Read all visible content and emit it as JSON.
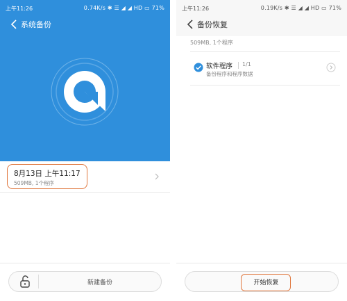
{
  "left": {
    "status": {
      "time": "上午11:26",
      "right": "0.74K/s ✱ ☰ ◢ ◢ HD ▭ 71%"
    },
    "title": "系统备份",
    "record": {
      "date": "8月13日 上午11:17",
      "sub": "509MB, 1个程序"
    },
    "bottom_button": "新建备份",
    "colors": {
      "header": "#2f8fdc",
      "highlight": "#e0763c"
    }
  },
  "right": {
    "status": {
      "time": "上午11:26",
      "right": "0.19K/s ✱ ☰ ◢ ◢ HD ▭ 71%"
    },
    "title": "备份恢复",
    "size_text": "509MB, 1个程序",
    "app_item": {
      "title": "软件程序",
      "count": "1/1",
      "sub": "备份程序和程序数据",
      "checked": true
    },
    "bottom_button": "开始恢复",
    "colors": {
      "check": "#2f8fdc",
      "highlight": "#e0763c"
    }
  }
}
